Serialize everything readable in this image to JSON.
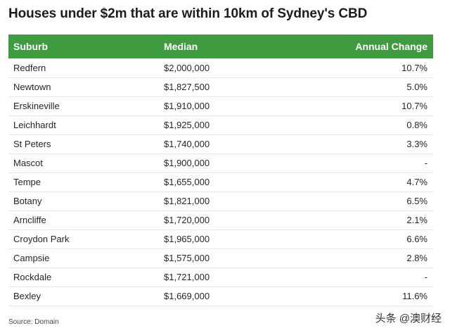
{
  "title": "Houses under $2m that are within 10km of Sydney's CBD",
  "table": {
    "headers": [
      "Suburb",
      "Median",
      "Annual Change"
    ],
    "header_color": "#3f9b3f",
    "rows": [
      [
        "Redfern",
        "$2,000,000",
        "10.7%"
      ],
      [
        "Newtown",
        "$1,827,500",
        "5.0%"
      ],
      [
        "Erskineville",
        "$1,910,000",
        "10.7%"
      ],
      [
        "Leichhardt",
        "$1,925,000",
        "0.8%"
      ],
      [
        "St Peters",
        "$1,740,000",
        "3.3%"
      ],
      [
        "Mascot",
        "$1,900,000",
        "-"
      ],
      [
        "Tempe",
        "$1,655,000",
        "4.7%"
      ],
      [
        "Botany",
        "$1,821,000",
        "6.5%"
      ],
      [
        "Arncliffe",
        "$1,720,000",
        "2.1%"
      ],
      [
        "Croydon Park",
        "$1,965,000",
        "6.6%"
      ],
      [
        "Campsie",
        "$1,575,000",
        "2.8%"
      ],
      [
        "Rockdale",
        "$1,721,000",
        "-"
      ],
      [
        "Bexley",
        "$1,669,000",
        "11.6%"
      ]
    ]
  },
  "source": "Source: Domain",
  "watermark": "头条 @澳财经"
}
